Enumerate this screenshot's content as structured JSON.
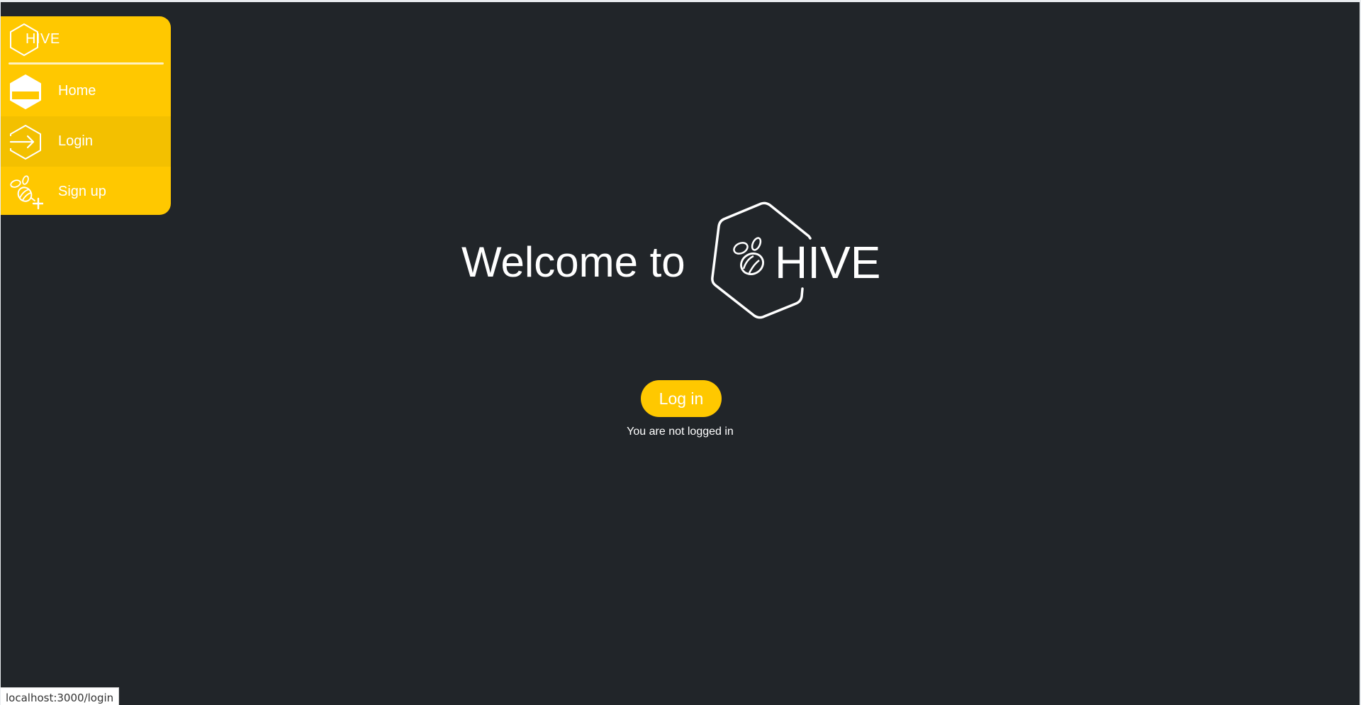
{
  "sidebar": {
    "brand": "HIVE",
    "items": [
      {
        "label": "Home",
        "icon": "home-hexagon-icon"
      },
      {
        "label": "Login",
        "icon": "login-arrow-icon",
        "active": true
      },
      {
        "label": "Sign up",
        "icon": "bee-plus-icon"
      }
    ]
  },
  "hero": {
    "welcome": "Welcome to",
    "brand": "HIVE",
    "logo_icon": "bee-hexagon-icon"
  },
  "login": {
    "button_label": "Log in",
    "status": "You are not logged in"
  },
  "status_bar": {
    "url": "localhost:3000/login"
  },
  "colors": {
    "background": "#212529",
    "accent": "#ffc800",
    "text": "#ffffff"
  }
}
